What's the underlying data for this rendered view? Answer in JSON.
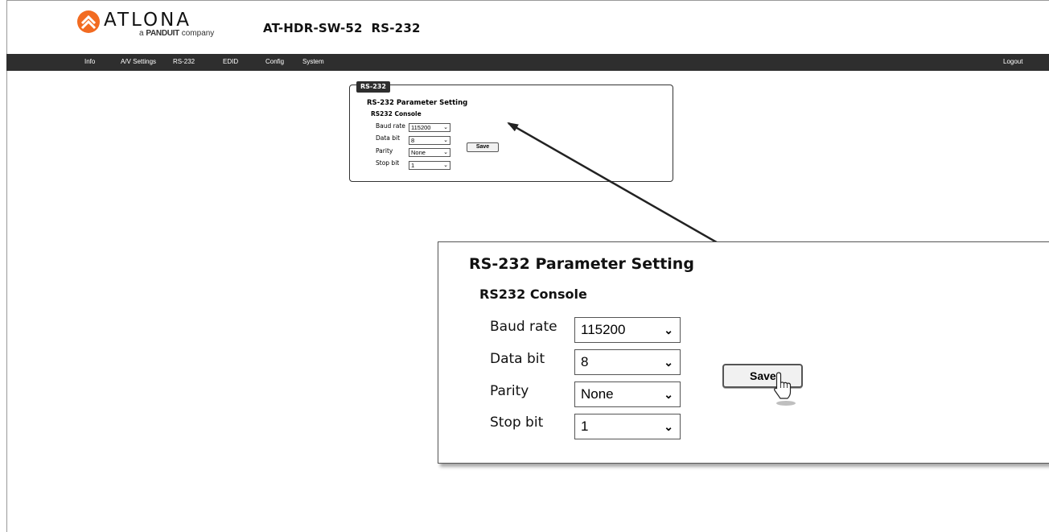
{
  "brand": {
    "wordmark": "ATLONA",
    "tagline_prefix": "a",
    "tagline_brand": "PANDUIT",
    "tagline_suffix": "company",
    "accent_color": "#f26b21"
  },
  "header": {
    "product_title": "AT-HDR-SW-52  RS-232"
  },
  "nav": {
    "items": [
      "Info",
      "A/V Settings",
      "RS-232",
      "EDID",
      "Config",
      "System"
    ],
    "logout": "Logout"
  },
  "panel": {
    "tab_label": "RS-232",
    "title": "RS-232 Parameter Setting",
    "subtitle": "RS232 Console",
    "fields": [
      {
        "label": "Baud rate",
        "value": "115200"
      },
      {
        "label": "Data bit",
        "value": "8"
      },
      {
        "label": "Parity",
        "value": "None"
      },
      {
        "label": "Stop bit",
        "value": "1"
      }
    ],
    "save_label": "Save"
  },
  "zoom": {
    "title": "RS-232 Parameter Setting",
    "subtitle": "RS232 Console",
    "fields": [
      {
        "label": "Baud rate",
        "value": "115200"
      },
      {
        "label": "Data bit",
        "value": "8"
      },
      {
        "label": "Parity",
        "value": "None"
      },
      {
        "label": "Stop bit",
        "value": "1"
      }
    ],
    "save_label": "Save"
  },
  "icons": {
    "chevron": "chevron-down-icon",
    "cursor": "hand-pointer-icon"
  }
}
